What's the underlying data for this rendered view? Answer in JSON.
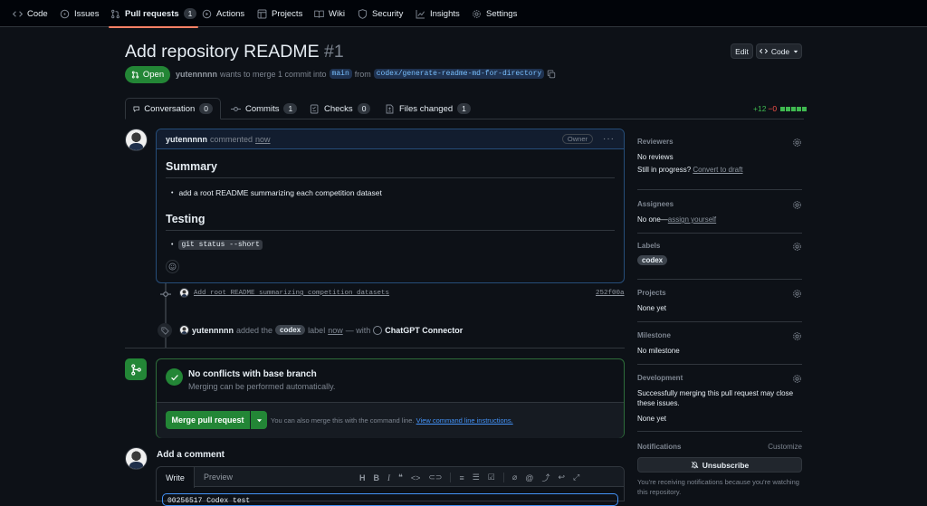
{
  "nav": {
    "code": "Code",
    "issues": "Issues",
    "pull_requests": "Pull requests",
    "pull_requests_count": "1",
    "actions": "Actions",
    "projects": "Projects",
    "wiki": "Wiki",
    "security": "Security",
    "insights": "Insights",
    "settings": "Settings"
  },
  "header": {
    "title": "Add repository README",
    "number": "#1",
    "edit_label": "Edit",
    "code_label": "Code",
    "status": "Open",
    "author": "yutennnnn",
    "merge_text": "wants to merge 1 commit into",
    "base_branch": "main",
    "from_text": "from",
    "head_branch": "codex/generate-readme-md-for-directory"
  },
  "tabs": [
    {
      "label": "Conversation",
      "count": "0"
    },
    {
      "label": "Commits",
      "count": "1"
    },
    {
      "label": "Checks",
      "count": "0"
    },
    {
      "label": "Files changed",
      "count": "1"
    }
  ],
  "diffstat": {
    "added": "+12",
    "removed": "−0"
  },
  "comment": {
    "author": "yutennnnn",
    "action": "commented",
    "time": "now",
    "badge": "Owner",
    "summary_heading": "Summary",
    "summary_item": "add a root README summarizing each competition dataset",
    "testing_heading": "Testing",
    "testing_item": "git status --short"
  },
  "commit": {
    "message": "Add root README summarizing competition datasets",
    "sha": "252f00a"
  },
  "label_event": {
    "user": "yutennnnn",
    "added_text": "added the",
    "label": "codex",
    "label_text": "label",
    "time": "now",
    "with_text": "— with",
    "connector": "ChatGPT Connector"
  },
  "merge": {
    "title": "No conflicts with base branch",
    "subtitle": "Merging can be performed automatically.",
    "button": "Merge pull request",
    "hint": "You can also merge this with the command line.",
    "hint_link": "View command line instructions."
  },
  "add_comment": {
    "heading": "Add a comment",
    "tab_write": "Write",
    "tab_preview": "Preview",
    "textarea_value": "00256517 Codex test"
  },
  "sidebar": {
    "reviewers_title": "Reviewers",
    "reviewers_value": "No reviews",
    "reviewers_progress": "Still in progress?",
    "reviewers_link": "Convert to draft",
    "assignees_title": "Assignees",
    "assignees_value": "No one—",
    "assignees_link": "assign yourself",
    "labels_title": "Labels",
    "labels_value": "codex",
    "projects_title": "Projects",
    "projects_value": "None yet",
    "milestone_title": "Milestone",
    "milestone_value": "No milestone",
    "development_title": "Development",
    "development_text": "Successfully merging this pull request may close these issues.",
    "development_value": "None yet",
    "notifications_title": "Notifications",
    "notifications_customize": "Customize",
    "unsubscribe_label": "Unsubscribe",
    "notifications_text": "You're receiving notifications because you're watching this repository."
  },
  "colors": {
    "accent_green": "#238636",
    "link_blue": "#4493f8",
    "nav_underline": "#f78166"
  }
}
